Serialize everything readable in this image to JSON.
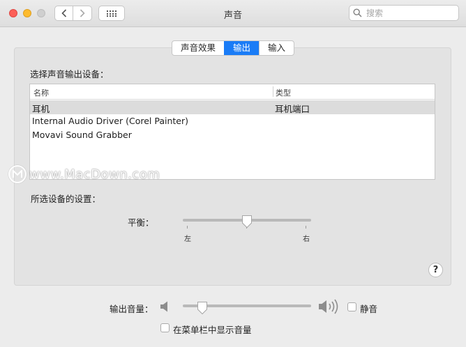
{
  "window": {
    "title": "声音"
  },
  "search": {
    "placeholder": "搜索"
  },
  "tabs": [
    {
      "label": "声音效果",
      "active": false
    },
    {
      "label": "输出",
      "active": true
    },
    {
      "label": "输入",
      "active": false
    }
  ],
  "output": {
    "section_label": "选择声音输出设备：",
    "columns": [
      "名称",
      "类型"
    ],
    "devices": [
      {
        "name": "耳机",
        "type": "耳机端口",
        "selected": true
      },
      {
        "name": "Internal Audio Driver (Corel Painter)",
        "type": "",
        "selected": false
      },
      {
        "name": "Movavi Sound Grabber",
        "type": "",
        "selected": false
      }
    ],
    "settings_label": "所选设备的设置：",
    "balance": {
      "label": "平衡：",
      "left": "左",
      "right": "右",
      "value": 0.5
    }
  },
  "watermark": {
    "text": "www.MacDown.com"
  },
  "bottom": {
    "volume_label": "输出音量：",
    "volume_value": 0.15,
    "mute_label": "静音",
    "mute_checked": false,
    "show_in_menubar_label": "在菜单栏中显示音量",
    "show_in_menubar_checked": false
  },
  "colors": {
    "accent": "#1a7cf6",
    "close": "#fc5f57",
    "minimize": "#fdbb2e",
    "zoom": "#cfcfcf"
  }
}
